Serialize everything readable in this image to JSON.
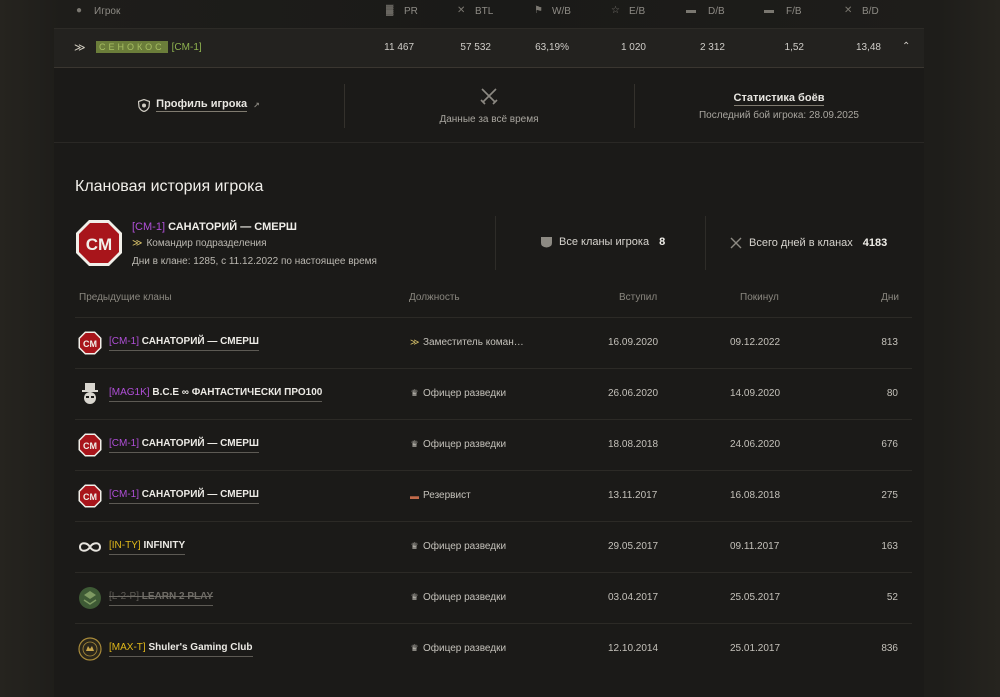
{
  "columns": {
    "player": "Игрок",
    "pr": "PR",
    "btl": "BTL",
    "wb": "W/B",
    "eb": "E/B",
    "db": "D/B",
    "fb": "F/B",
    "bd": "B/D"
  },
  "player": {
    "name": "СЕНОКОС",
    "tag": "[CM-1]",
    "pr": "11 467",
    "btl": "57 532",
    "wb": "63,19%",
    "eb": "1 020",
    "db": "2 312",
    "fb": "1,52",
    "bd": "13,48"
  },
  "info": {
    "profile_link": "Профиль игрока",
    "alltime": "Данные за всё время",
    "stats_link": "Статистика боёв",
    "last_battle": "Последний бой игрока: 28.09.2025"
  },
  "clan_history": {
    "title": "Клановая история игрока",
    "current": {
      "tag": "[CM-1]",
      "name": "САНАТОРИЙ — СМЕРШ",
      "role": "Командир подразделения",
      "days_text": "Дни в клане: 1285, с 11.12.2022 по настоящее время",
      "all_clans_label": "Все кланы игрока",
      "all_clans_count": "8",
      "total_days_label": "Всего дней в кланах",
      "total_days": "4183",
      "emblem_text": "CM"
    },
    "headers": {
      "clan": "Предыдущие кланы",
      "role": "Должность",
      "joined": "Вступил",
      "left": "Покинул",
      "days": "Дни"
    },
    "rows": [
      {
        "tag": "[CM-1]",
        "name": "САНАТОРИЙ — СМЕРШ",
        "role": "Заместитель коман…",
        "joined": "16.09.2020",
        "left": "09.12.2022",
        "days": "813",
        "tag_color": "#b04fd8",
        "emblem": "cm",
        "role_icon": "stripes"
      },
      {
        "tag": "[MAG1K]",
        "name": "B.C.E ∞ ФАНТАСТИЧЕСКИ ПРО100",
        "role": "Офицер разведки",
        "joined": "26.06.2020",
        "left": "14.09.2020",
        "days": "80",
        "tag_color": "#b04fd8",
        "emblem": "hat",
        "role_icon": "crown"
      },
      {
        "tag": "[CM-1]",
        "name": "САНАТОРИЙ — СМЕРШ",
        "role": "Офицер разведки",
        "joined": "18.08.2018",
        "left": "24.06.2020",
        "days": "676",
        "tag_color": "#b04fd8",
        "emblem": "cm",
        "role_icon": "crown"
      },
      {
        "tag": "[CM-1]",
        "name": "САНАТОРИЙ — СМЕРШ",
        "role": "Резервист",
        "joined": "13.11.2017",
        "left": "16.08.2018",
        "days": "275",
        "tag_color": "#b04fd8",
        "emblem": "cm",
        "role_icon": "bar"
      },
      {
        "tag": "[IN-TY]",
        "name": "INFINITY",
        "role": "Офицер разведки",
        "joined": "29.05.2017",
        "left": "09.11.2017",
        "days": "163",
        "tag_color": "#e0b81a",
        "emblem": "infinity",
        "role_icon": "crown"
      },
      {
        "tag": "[L-2-P]",
        "name": "LEARN 2 PLAY",
        "role": "Офицер разведки",
        "joined": "03.04.2017",
        "left": "25.05.2017",
        "days": "52",
        "tag_color": "#6f6c66",
        "emblem": "l2p",
        "role_icon": "crown",
        "dim": true
      },
      {
        "tag": "[MAX-T]",
        "name": "Shuler's Gaming Club",
        "role": "Офицер разведки",
        "joined": "12.10.2014",
        "left": "25.01.2017",
        "days": "836",
        "tag_color": "#e0b81a",
        "emblem": "max",
        "role_icon": "crown"
      }
    ]
  }
}
